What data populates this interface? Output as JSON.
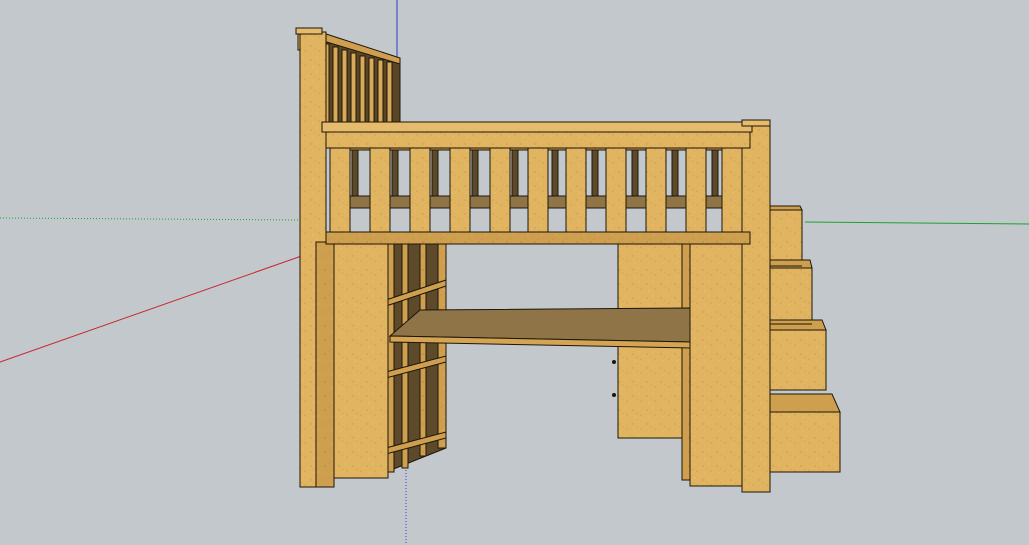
{
  "viewport": {
    "background": "#c3c8cc",
    "model": "loft-bed-with-desk-and-stairs",
    "axes": {
      "red": "#c8232d",
      "green": "#1aa32e",
      "blue": "#2e3cc8"
    },
    "materials": {
      "wood_light": "#e2b563",
      "wood_mid": "#d3a453",
      "wood_dark": "#b58a45",
      "desk_top": "#8f7448",
      "edge": "#1e1608"
    }
  }
}
